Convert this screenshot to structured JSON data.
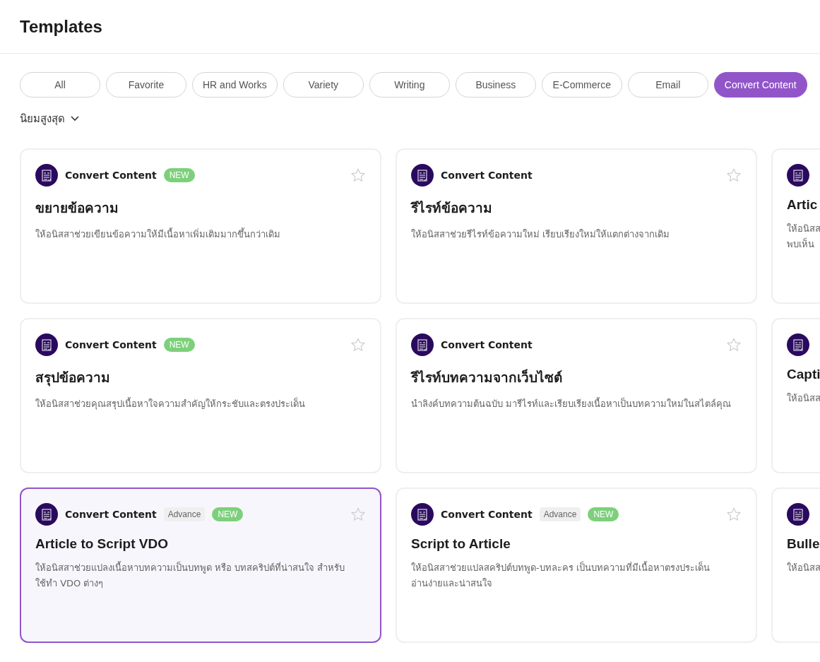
{
  "page": {
    "title": "Templates"
  },
  "tabs": [
    {
      "label": "All",
      "selected": false
    },
    {
      "label": "Favorite",
      "selected": false
    },
    {
      "label": "HR and Works",
      "selected": false
    },
    {
      "label": "Variety",
      "selected": false
    },
    {
      "label": "Writing",
      "selected": false
    },
    {
      "label": "Business",
      "selected": false
    },
    {
      "label": "E-Commerce",
      "selected": false
    },
    {
      "label": "Email",
      "selected": false
    },
    {
      "label": "Convert Content",
      "selected": true
    }
  ],
  "sort": {
    "label": "นิยมสูงสุด"
  },
  "cards": [
    {
      "category": "Convert Content",
      "badges": [
        {
          "kind": "new",
          "label": "NEW"
        }
      ],
      "favorite": false,
      "selected": false,
      "title": "ขยายข้อความ",
      "description_lines": [
        "ให้อนิสสาช่วยเขียนข้อความให้มีเนื้อหาเพิ่มเติมมากขึ้นกว่าเดิม"
      ]
    },
    {
      "category": "Convert Content",
      "favorite": false,
      "selected": false,
      "title": "รีไรท์ข้อความ",
      "description_lines": [
        "ให้อนิสสาช่วยรีไรท์ข้อความใหม่ เรียบเรียงใหม่ให้แตกต่างจากเดิม"
      ]
    },
    {
      "selected": false,
      "title": "Artic",
      "description_lines": [
        "ให้อนิสส",
        "พบเห็น"
      ]
    },
    {
      "category": "Convert Content",
      "badges": [
        {
          "kind": "new",
          "label": "NEW"
        }
      ],
      "favorite": false,
      "selected": false,
      "title": "สรุปข้อความ",
      "description_lines": [
        "ให้อนิสสาช่วยคุณสรุปเนื้อหาใจความสำคัญให้กระชับและตรงประเด็น"
      ]
    },
    {
      "category": "Convert Content",
      "favorite": false,
      "selected": false,
      "title": "รีไรท์บทความจากเว็บไซต์",
      "description_lines": [
        "นำลิงค์บทความต้นฉบับ มารีไรท์และเรียบเรียงเนื้อหาเป็นบทความใหม่ในสไตล์คุณ"
      ]
    },
    {
      "selected": false,
      "title": "Capti",
      "description_lines": [
        "ให้อนิสส"
      ]
    },
    {
      "category": "Convert Content",
      "badges": [
        {
          "kind": "advance",
          "label": "Advance"
        },
        {
          "kind": "new",
          "label": "NEW"
        }
      ],
      "favorite": false,
      "selected": true,
      "title": "Article to Script VDO",
      "description_lines": [
        "ให้อนิสสาช่วยแปลงเนื้อหาบทความเป็นบทพูด หรือ บทสคริปต์ที่น่าสนใจ สำหรับ",
        "ใช้ทำ VDO ต่างๆ"
      ]
    },
    {
      "category": "Convert Content",
      "badges": [
        {
          "kind": "advance",
          "label": "Advance"
        },
        {
          "kind": "new",
          "label": "NEW"
        }
      ],
      "favorite": false,
      "selected": false,
      "title": "Script to Article",
      "description_lines": [
        "ให้อนิสสาช่วยแปลสคริปต์บทพูด-บทละคร เป็นบทความที่มีเนื้อหาตรงประเด็น",
        "อ่านง่ายและน่าสนใจ"
      ]
    },
    {
      "selected": false,
      "title": "Bulle",
      "description_lines": [
        "ให้อนิสส"
      ]
    }
  ]
}
